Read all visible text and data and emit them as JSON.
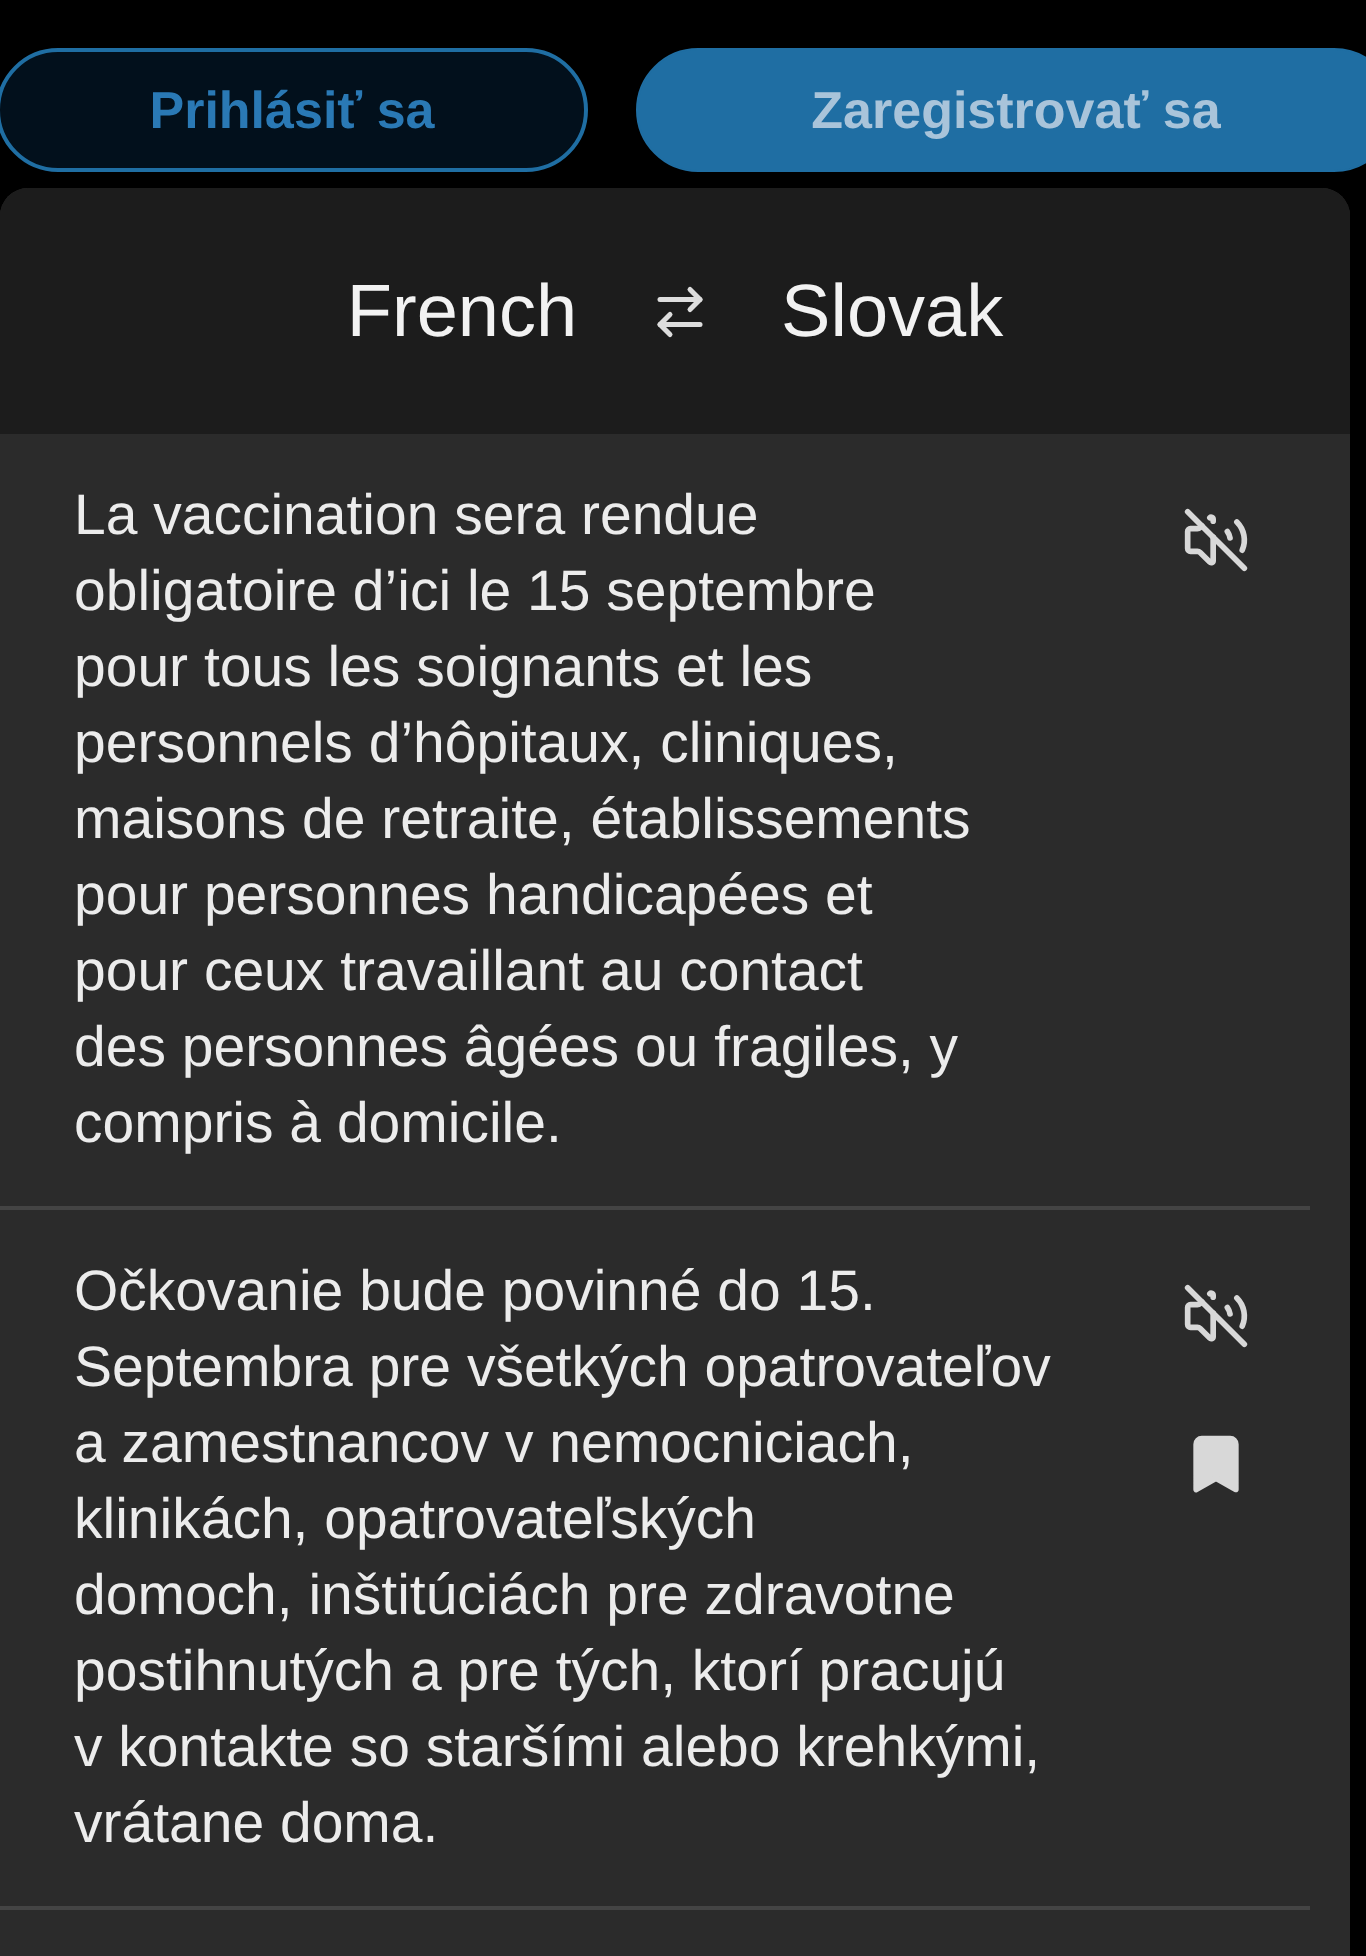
{
  "auth_buttons": [
    {
      "label": "Prihlásiť sa",
      "kind": "outline"
    },
    {
      "label": "Zaregistrovať sa",
      "kind": "filled"
    }
  ],
  "translator": {
    "source_language": "French",
    "target_language": "Slovak",
    "entries": [
      {
        "text": "La vaccination sera rendue\nobligatoire d’ici le 15 septembre\npour tous les soignants et les\npersonnels d’hôpitaux, cliniques,\nmaisons de retraite, établissements\npour personnes handicapées et\npour ceux travaillant au contact\ndes personnes âgées ou fragiles, y\ncompris à domicile.",
        "bookmarked": false
      },
      {
        "text": "Očkovanie bude povinné do 15.\nSeptembra pre všetkých opatrovateľov\na zamestnancov v nemocniciach,\nklinikách, opatrovateľských\ndomoch, inštitúciách pre zdravotne\npostihnutých a pre tých, ktorí pracujú\nv kontakte so staršími alebo krehkými,\nvrátane doma.",
        "bookmarked": true
      }
    ]
  }
}
